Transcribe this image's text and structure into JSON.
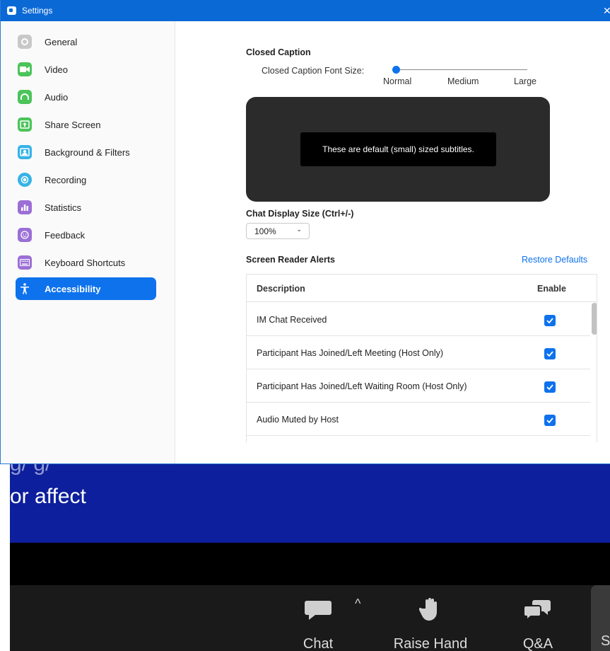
{
  "window": {
    "title": "Settings",
    "close_glyph": "✕"
  },
  "sidebar": {
    "items": [
      {
        "label": "General",
        "icon": "gear-icon",
        "color": "#c8c8c8",
        "active": false
      },
      {
        "label": "Video",
        "icon": "video-camera-icon",
        "color": "#4bc45a",
        "active": false
      },
      {
        "label": "Audio",
        "icon": "headphones-icon",
        "color": "#4bc45a",
        "active": false
      },
      {
        "label": "Share Screen",
        "icon": "share-screen-icon",
        "color": "#4bc45a",
        "active": false
      },
      {
        "label": "Background & Filters",
        "icon": "background-filter-icon",
        "color": "#36b3e6",
        "active": false
      },
      {
        "label": "Recording",
        "icon": "record-icon",
        "color": "#36b3e6",
        "active": false
      },
      {
        "label": "Statistics",
        "icon": "statistics-icon",
        "color": "#9b6fd6",
        "active": false
      },
      {
        "label": "Feedback",
        "icon": "smiley-icon",
        "color": "#9b6fd6",
        "active": false
      },
      {
        "label": "Keyboard Shortcuts",
        "icon": "keyboard-icon",
        "color": "#9b6fd6",
        "active": false
      },
      {
        "label": "Accessibility",
        "icon": "accessibility-icon",
        "color": "#0e72ed",
        "active": true
      }
    ]
  },
  "main": {
    "closed_caption": {
      "heading": "Closed Caption",
      "font_size_label": "Closed Caption Font Size:",
      "slider_options": [
        "Normal",
        "Medium",
        "Large"
      ],
      "slider_value": "Normal",
      "preview_text": "These are default (small) sized subtitles."
    },
    "chat_display": {
      "heading": "Chat Display Size (Ctrl+/-)",
      "selected": "100%"
    },
    "screen_reader": {
      "heading": "Screen Reader Alerts",
      "restore_label": "Restore Defaults",
      "columns": [
        "Description",
        "Enable"
      ],
      "rows": [
        {
          "description": "IM Chat Received",
          "enabled": true
        },
        {
          "description": "Participant Has Joined/Left Meeting (Host Only)",
          "enabled": true
        },
        {
          "description": "Participant Has Joined/Left Waiting Room (Host Only)",
          "enabled": true
        },
        {
          "description": "Audio Muted by Host",
          "enabled": true
        }
      ]
    }
  },
  "background": {
    "slide_partial_text": "g/ g/",
    "slide_text": "or affect",
    "toolbar": {
      "chat_label": "Chat",
      "caret": "^",
      "raise_hand_label": "Raise Hand",
      "qa_label": "Q&A",
      "partial_label": "S"
    }
  },
  "colors": {
    "accent": "#0e72ed",
    "titlebar": "#0b69d6",
    "slide_background": "#0d1f9c",
    "toolbar_background": "#1a1a1a"
  }
}
